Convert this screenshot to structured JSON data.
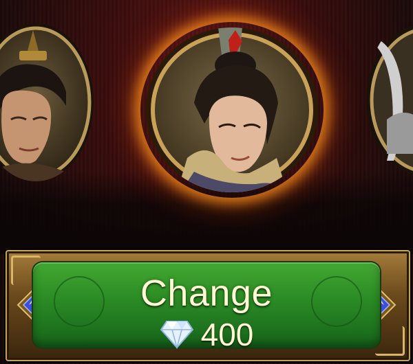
{
  "portraits": [
    {
      "id": "left",
      "label": ""
    },
    {
      "id": "center",
      "label": "",
      "selected": true
    },
    {
      "id": "right",
      "label": ""
    }
  ],
  "button": {
    "label": "Change",
    "cost": "400",
    "cost_icon": "diamond-icon"
  },
  "colors": {
    "button_green": "#2a8a24",
    "frame_gold": "#c9a25a",
    "text_cream": "#fff9d6",
    "glow_orange": "#ff961e",
    "background_red": "#3a0d0d"
  }
}
